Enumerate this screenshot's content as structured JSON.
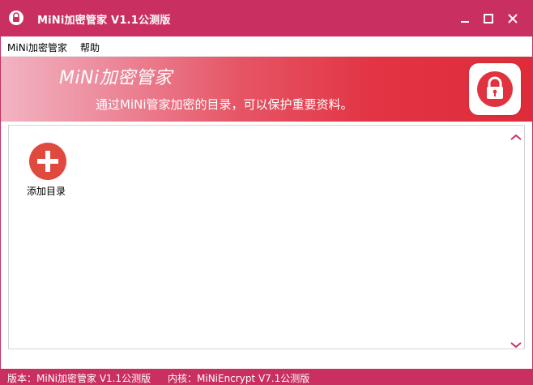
{
  "window": {
    "title": "MiNi加密管家 V1.1公测版",
    "colors": {
      "titlebar": "#c93061",
      "statusbar": "#c93061",
      "accent": "#e0323f"
    },
    "icons": {
      "app": "lock-icon",
      "minimize": "minimize-icon",
      "maximize": "maximize-icon",
      "close": "close-icon"
    }
  },
  "menu": {
    "items": [
      {
        "label": "MiNi加密管家"
      },
      {
        "label": "帮助"
      }
    ]
  },
  "banner": {
    "title": "MiNi加密管家",
    "subtitle": "通过MiNi管家加密的目录，可以保护重要资料。",
    "icon": "padlock-icon"
  },
  "content": {
    "add_directory_label": "添加目录",
    "add_icon": "plus-circle-icon",
    "scroll_up_icon": "chevron-up-icon",
    "scroll_down_icon": "chevron-down-icon"
  },
  "status": {
    "version": "版本：MiNi加密管家 V1.1公测版",
    "kernel": "内核：MiNiEncrypt V7.1公测版"
  }
}
